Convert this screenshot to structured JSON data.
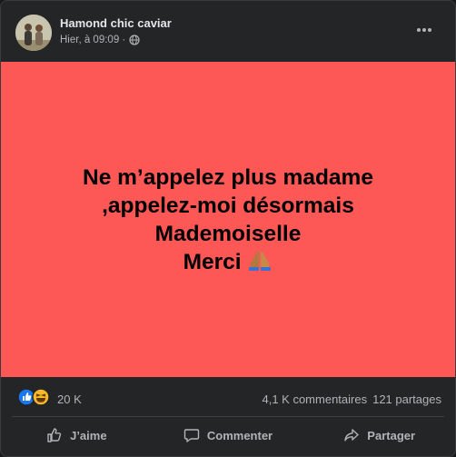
{
  "post": {
    "author_name": "Hamond chic caviar",
    "timestamp": "Hier, à 09:09 ·",
    "audience_icon": "globe-icon",
    "text_lines": [
      "Ne m’appelez plus madame",
      ",appelez-moi désormais",
      "Mademoiselle",
      "Merci"
    ],
    "emoji": "folded-hands-icon",
    "background_color": "#fd5756"
  },
  "stats": {
    "reaction_icons": [
      "like-icon",
      "haha-icon"
    ],
    "reactions_count": "20 K",
    "comments": "4,1 K commentaires",
    "shares": "121 partages"
  },
  "actions": {
    "like_label": "J’aime",
    "comment_label": "Commenter",
    "share_label": "Partager"
  },
  "colors": {
    "card_bg": "#242526",
    "like_blue": "#1877f2",
    "haha_yellow": "#f7b928"
  }
}
